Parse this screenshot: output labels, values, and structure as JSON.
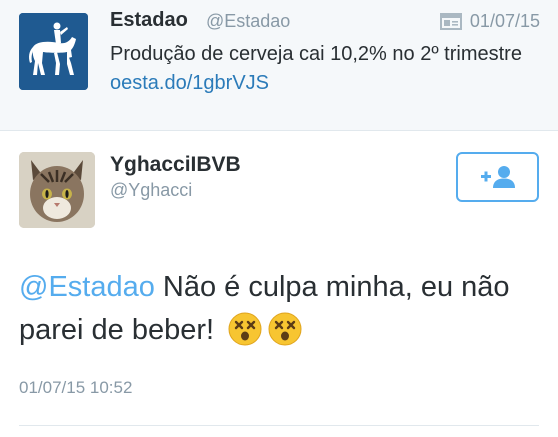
{
  "quoted_tweet": {
    "name": "Estadao",
    "handle": "@Estadao",
    "date": "01/07/15",
    "text": "Produção de cerveja cai 10,2% no 2º trimestre ",
    "link": "oesta.do/1gbrVJS",
    "avatar_icon": "horse-rider-logo-icon",
    "brand_color": "#1f5a91"
  },
  "tweet": {
    "name": "YghacciIBVB",
    "handle": "@Yghacci",
    "mention": "@Estadao",
    "text": " Não é culpa minha, eu não parei de beber!",
    "emojis": [
      "dizzy-face-icon",
      "dizzy-face-icon"
    ],
    "timestamp": "01/07/15 10:52",
    "avatar_icon": "cat-avatar-icon",
    "follow_icon": "add-user-icon"
  },
  "colors": {
    "accent": "#55acee",
    "link": "#2b7bb9",
    "muted": "#8899a6",
    "text": "#292f33"
  }
}
